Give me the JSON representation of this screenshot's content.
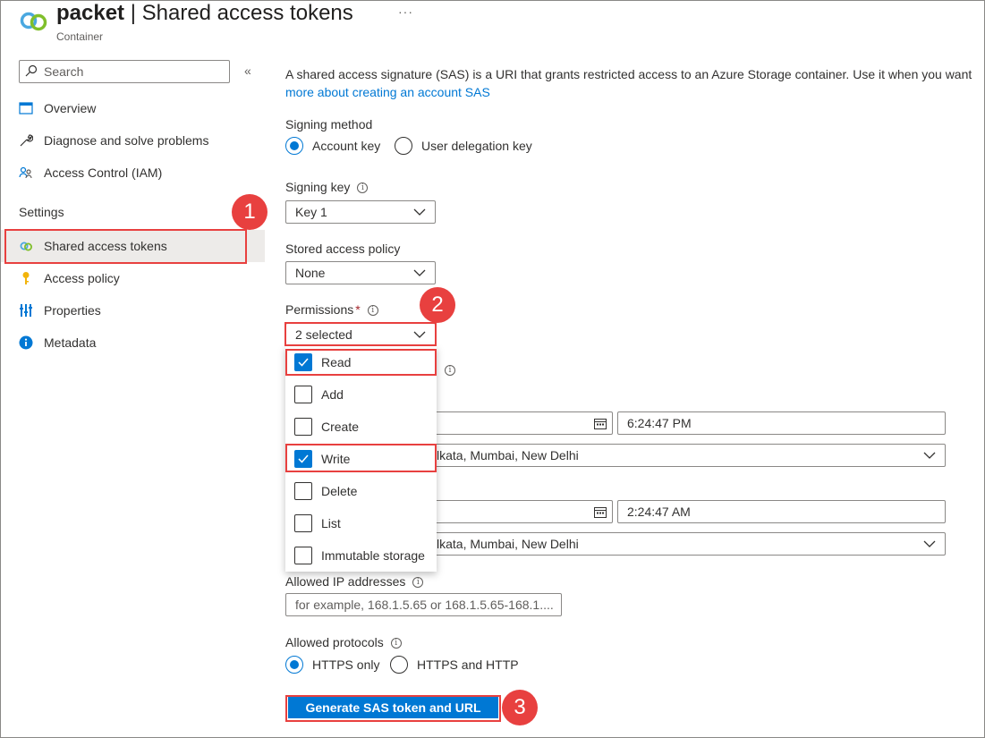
{
  "header": {
    "resource_name": "packet",
    "separator": "|",
    "page_title": "Shared access tokens",
    "subtitle": "Container",
    "more": "···"
  },
  "sidebar": {
    "search_placeholder": "Search",
    "collapse": "«",
    "items": [
      {
        "label": "Overview",
        "icon": "overview-icon"
      },
      {
        "label": "Diagnose and solve problems",
        "icon": "wrench-icon"
      },
      {
        "label": "Access Control (IAM)",
        "icon": "people-icon"
      }
    ],
    "settings_heading": "Settings",
    "settings_items": [
      {
        "label": "Shared access tokens",
        "icon": "link-icon",
        "active": true
      },
      {
        "label": "Access policy",
        "icon": "key-icon"
      },
      {
        "label": "Properties",
        "icon": "bars-icon"
      },
      {
        "label": "Metadata",
        "icon": "info-icon"
      }
    ]
  },
  "main": {
    "description": "A shared access signature (SAS) is a URI that grants restricted access to an Azure Storage container. Use it when you want",
    "description_link": "more about creating an account SAS",
    "signing_method": {
      "label": "Signing method",
      "options": [
        "Account key",
        "User delegation key"
      ],
      "selected": "Account key"
    },
    "signing_key": {
      "label": "Signing key",
      "value": "Key 1"
    },
    "stored_policy": {
      "label": "Stored access policy",
      "value": "None"
    },
    "permissions": {
      "label": "Permissions",
      "required": "*",
      "value": "2 selected",
      "options": [
        {
          "label": "Read",
          "checked": true
        },
        {
          "label": "Add",
          "checked": false
        },
        {
          "label": "Create",
          "checked": false
        },
        {
          "label": "Write",
          "checked": true
        },
        {
          "label": "Delete",
          "checked": false
        },
        {
          "label": "List",
          "checked": false
        },
        {
          "label": "Immutable storage",
          "checked": false
        }
      ]
    },
    "start": {
      "time": "6:24:47 PM",
      "timezone_partial": "lkata, Mumbai, New Delhi"
    },
    "expiry": {
      "time": "2:24:47 AM",
      "timezone_partial": "lkata, Mumbai, New Delhi"
    },
    "allowed_ip": {
      "label": "Allowed IP addresses",
      "placeholder": "for example, 168.1.5.65 or 168.1.5.65-168.1...."
    },
    "allowed_protocols": {
      "label": "Allowed protocols",
      "options": [
        "HTTPS only",
        "HTTPS and HTTP"
      ],
      "selected": "HTTPS only"
    },
    "generate_button": "Generate SAS token and URL"
  },
  "annotations": {
    "step1": "1",
    "step2": "2",
    "step3": "3",
    "color": "#e8403f"
  },
  "colors": {
    "accent": "#0078d4",
    "active_bg": "#edebe9"
  }
}
